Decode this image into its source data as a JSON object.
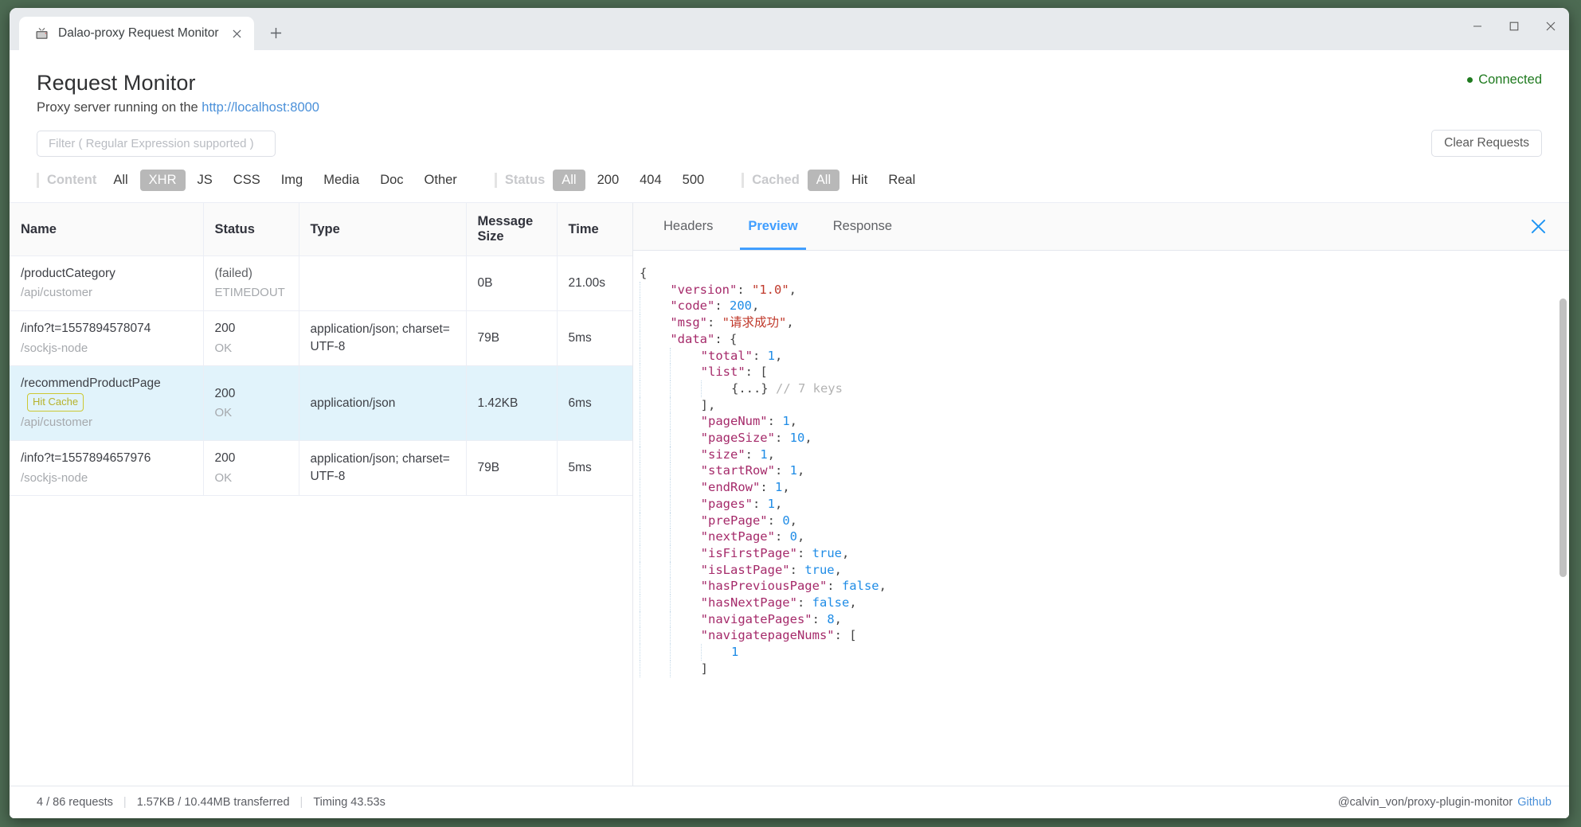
{
  "browser": {
    "tab": {
      "title": "Dalao-proxy Request Monitor",
      "favicon_icon": "tv-icon",
      "close_icon": "close-icon"
    },
    "new_tab_icon": "plus-icon",
    "window_controls": {
      "minimize_icon": "minimize-icon",
      "maximize_icon": "maximize-icon",
      "close_icon": "close-icon"
    }
  },
  "header": {
    "title": "Request Monitor",
    "subtitle_prefix": "Proxy server running on the ",
    "proxy_url": "http://localhost:8000",
    "connection_status": "Connected",
    "connection_color": "#1f7a1f"
  },
  "toolbar": {
    "filter_placeholder": "Filter ( Regular Expression supported )",
    "filter_value": "",
    "clear_label": "Clear Requests"
  },
  "filters": [
    {
      "label": "Content",
      "options": [
        "All",
        "XHR",
        "JS",
        "CSS",
        "Img",
        "Media",
        "Doc",
        "Other"
      ],
      "selected": "XHR"
    },
    {
      "label": "Status",
      "options": [
        "All",
        "200",
        "404",
        "500"
      ],
      "selected": "All"
    },
    {
      "label": "Cached",
      "options": [
        "All",
        "Hit",
        "Real"
      ],
      "selected": "All"
    }
  ],
  "table": {
    "columns": [
      "Name",
      "Status",
      "Type",
      "Message Size",
      "Time"
    ],
    "rows": [
      {
        "name": "/productCategory",
        "path": "/api/customer",
        "badge": "",
        "status": "(failed)",
        "status_sub": "ETIMEDOUT",
        "type": "",
        "size": "0B",
        "time": "21.00s",
        "selected": false
      },
      {
        "name": "/info?t=1557894578074",
        "path": "/sockjs-node",
        "badge": "",
        "status": "200",
        "status_sub": "OK",
        "type": "application/json; charset=UTF-8",
        "size": "79B",
        "time": "5ms",
        "selected": false
      },
      {
        "name": "/recommendProductPage",
        "path": "/api/customer",
        "badge": "Hit Cache",
        "status": "200",
        "status_sub": "OK",
        "type": "application/json",
        "size": "1.42KB",
        "time": "6ms",
        "selected": true
      },
      {
        "name": "/info?t=1557894657976",
        "path": "/sockjs-node",
        "badge": "",
        "status": "200",
        "status_sub": "OK",
        "type": "application/json; charset=UTF-8",
        "size": "79B",
        "time": "5ms",
        "selected": false
      }
    ]
  },
  "detail": {
    "tabs": [
      "Headers",
      "Preview",
      "Response"
    ],
    "active_tab": "Preview",
    "close_icon": "close-icon",
    "preview_lines": [
      {
        "indent": 0,
        "tokens": [
          {
            "t": "{",
            "c": "jpunct"
          }
        ]
      },
      {
        "indent": 1,
        "tokens": [
          {
            "t": "\"version\"",
            "c": "jkey"
          },
          {
            "t": ": ",
            "c": "jpunct"
          },
          {
            "t": "\"1.0\"",
            "c": "jstr"
          },
          {
            "t": ",",
            "c": "jpunct"
          }
        ]
      },
      {
        "indent": 1,
        "tokens": [
          {
            "t": "\"code\"",
            "c": "jkey"
          },
          {
            "t": ": ",
            "c": "jpunct"
          },
          {
            "t": "200",
            "c": "jnum"
          },
          {
            "t": ",",
            "c": "jpunct"
          }
        ]
      },
      {
        "indent": 1,
        "tokens": [
          {
            "t": "\"msg\"",
            "c": "jkey"
          },
          {
            "t": ": ",
            "c": "jpunct"
          },
          {
            "t": "\"请求成功\"",
            "c": "jstr"
          },
          {
            "t": ",",
            "c": "jpunct"
          }
        ]
      },
      {
        "indent": 1,
        "tokens": [
          {
            "t": "\"data\"",
            "c": "jkey"
          },
          {
            "t": ": {",
            "c": "jpunct"
          }
        ]
      },
      {
        "indent": 2,
        "tokens": [
          {
            "t": "\"total\"",
            "c": "jkey"
          },
          {
            "t": ": ",
            "c": "jpunct"
          },
          {
            "t": "1",
            "c": "jnum"
          },
          {
            "t": ",",
            "c": "jpunct"
          }
        ]
      },
      {
        "indent": 2,
        "tokens": [
          {
            "t": "\"list\"",
            "c": "jkey"
          },
          {
            "t": ": [",
            "c": "jpunct"
          }
        ]
      },
      {
        "indent": 3,
        "tokens": [
          {
            "t": "{...}",
            "c": "jpunct"
          },
          {
            "t": " // 7 keys",
            "c": "jcomment"
          }
        ]
      },
      {
        "indent": 2,
        "tokens": [
          {
            "t": "],",
            "c": "jpunct"
          }
        ]
      },
      {
        "indent": 2,
        "tokens": [
          {
            "t": "\"pageNum\"",
            "c": "jkey"
          },
          {
            "t": ": ",
            "c": "jpunct"
          },
          {
            "t": "1",
            "c": "jnum"
          },
          {
            "t": ",",
            "c": "jpunct"
          }
        ]
      },
      {
        "indent": 2,
        "tokens": [
          {
            "t": "\"pageSize\"",
            "c": "jkey"
          },
          {
            "t": ": ",
            "c": "jpunct"
          },
          {
            "t": "10",
            "c": "jnum"
          },
          {
            "t": ",",
            "c": "jpunct"
          }
        ]
      },
      {
        "indent": 2,
        "tokens": [
          {
            "t": "\"size\"",
            "c": "jkey"
          },
          {
            "t": ": ",
            "c": "jpunct"
          },
          {
            "t": "1",
            "c": "jnum"
          },
          {
            "t": ",",
            "c": "jpunct"
          }
        ]
      },
      {
        "indent": 2,
        "tokens": [
          {
            "t": "\"startRow\"",
            "c": "jkey"
          },
          {
            "t": ": ",
            "c": "jpunct"
          },
          {
            "t": "1",
            "c": "jnum"
          },
          {
            "t": ",",
            "c": "jpunct"
          }
        ]
      },
      {
        "indent": 2,
        "tokens": [
          {
            "t": "\"endRow\"",
            "c": "jkey"
          },
          {
            "t": ": ",
            "c": "jpunct"
          },
          {
            "t": "1",
            "c": "jnum"
          },
          {
            "t": ",",
            "c": "jpunct"
          }
        ]
      },
      {
        "indent": 2,
        "tokens": [
          {
            "t": "\"pages\"",
            "c": "jkey"
          },
          {
            "t": ": ",
            "c": "jpunct"
          },
          {
            "t": "1",
            "c": "jnum"
          },
          {
            "t": ",",
            "c": "jpunct"
          }
        ]
      },
      {
        "indent": 2,
        "tokens": [
          {
            "t": "\"prePage\"",
            "c": "jkey"
          },
          {
            "t": ": ",
            "c": "jpunct"
          },
          {
            "t": "0",
            "c": "jnum"
          },
          {
            "t": ",",
            "c": "jpunct"
          }
        ]
      },
      {
        "indent": 2,
        "tokens": [
          {
            "t": "\"nextPage\"",
            "c": "jkey"
          },
          {
            "t": ": ",
            "c": "jpunct"
          },
          {
            "t": "0",
            "c": "jnum"
          },
          {
            "t": ",",
            "c": "jpunct"
          }
        ]
      },
      {
        "indent": 2,
        "tokens": [
          {
            "t": "\"isFirstPage\"",
            "c": "jkey"
          },
          {
            "t": ": ",
            "c": "jpunct"
          },
          {
            "t": "true",
            "c": "jbool"
          },
          {
            "t": ",",
            "c": "jpunct"
          }
        ]
      },
      {
        "indent": 2,
        "tokens": [
          {
            "t": "\"isLastPage\"",
            "c": "jkey"
          },
          {
            "t": ": ",
            "c": "jpunct"
          },
          {
            "t": "true",
            "c": "jbool"
          },
          {
            "t": ",",
            "c": "jpunct"
          }
        ]
      },
      {
        "indent": 2,
        "tokens": [
          {
            "t": "\"hasPreviousPage\"",
            "c": "jkey"
          },
          {
            "t": ": ",
            "c": "jpunct"
          },
          {
            "t": "false",
            "c": "jbool"
          },
          {
            "t": ",",
            "c": "jpunct"
          }
        ]
      },
      {
        "indent": 2,
        "tokens": [
          {
            "t": "\"hasNextPage\"",
            "c": "jkey"
          },
          {
            "t": ": ",
            "c": "jpunct"
          },
          {
            "t": "false",
            "c": "jbool"
          },
          {
            "t": ",",
            "c": "jpunct"
          }
        ]
      },
      {
        "indent": 2,
        "tokens": [
          {
            "t": "\"navigatePages\"",
            "c": "jkey"
          },
          {
            "t": ": ",
            "c": "jpunct"
          },
          {
            "t": "8",
            "c": "jnum"
          },
          {
            "t": ",",
            "c": "jpunct"
          }
        ]
      },
      {
        "indent": 2,
        "tokens": [
          {
            "t": "\"navigatepageNums\"",
            "c": "jkey"
          },
          {
            "t": ": [",
            "c": "jpunct"
          }
        ]
      },
      {
        "indent": 3,
        "tokens": [
          {
            "t": "1",
            "c": "jnum"
          }
        ]
      },
      {
        "indent": 2,
        "tokens": [
          {
            "t": "]",
            "c": "jpunct"
          }
        ]
      }
    ]
  },
  "footer": {
    "requests": "4 / 86 requests",
    "transferred": "1.57KB / 10.44MB transferred",
    "timing": "Timing 43.53s",
    "credit": "@calvin_von/proxy-plugin-monitor",
    "github_label": "Github"
  }
}
